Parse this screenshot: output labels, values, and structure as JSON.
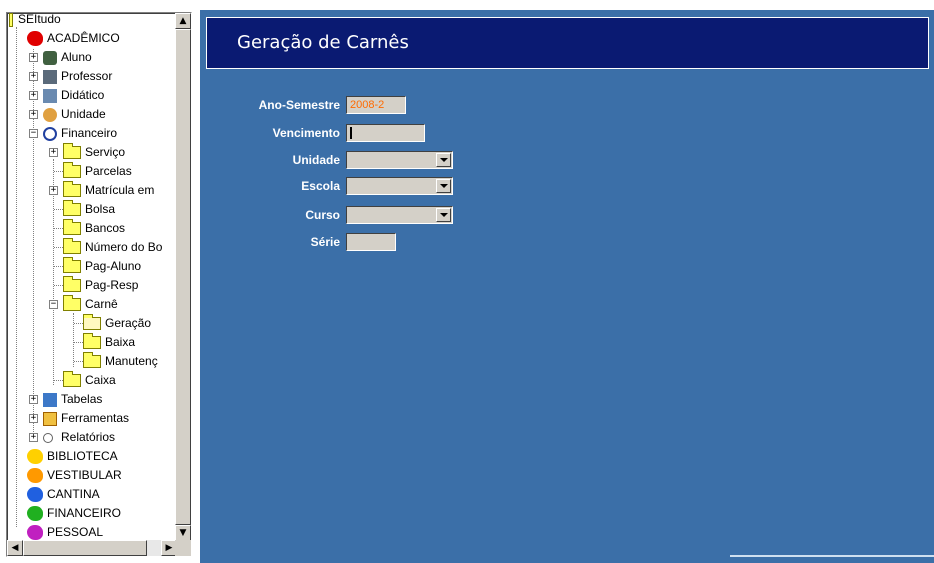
{
  "tree": {
    "root": "SEItudo",
    "items": [
      {
        "label": "ACADÊMICO"
      },
      {
        "label": "Aluno"
      },
      {
        "label": "Professor"
      },
      {
        "label": "Didático"
      },
      {
        "label": "Unidade"
      },
      {
        "label": "Financeiro"
      },
      {
        "label": "Serviço"
      },
      {
        "label": "Parcelas"
      },
      {
        "label": "Matrícula em"
      },
      {
        "label": "Bolsa"
      },
      {
        "label": "Bancos"
      },
      {
        "label": "Número do Bo"
      },
      {
        "label": "Pag-Aluno"
      },
      {
        "label": "Pag-Resp"
      },
      {
        "label": "Carnê"
      },
      {
        "label": "Geração"
      },
      {
        "label": "Baixa"
      },
      {
        "label": "Manutenç"
      },
      {
        "label": "Caixa"
      },
      {
        "label": "Tabelas"
      },
      {
        "label": "Ferramentas"
      },
      {
        "label": "Relatórios"
      },
      {
        "label": "BIBLIOTECA"
      },
      {
        "label": "VESTIBULAR"
      },
      {
        "label": "CANTINA"
      },
      {
        "label": "FINANCEIRO"
      },
      {
        "label": "PESSOAL"
      }
    ]
  },
  "main": {
    "title": "Geração de Carnês",
    "form": {
      "ano_semestre": {
        "label": "Ano-Semestre",
        "value": "2008-2"
      },
      "vencimento": {
        "label": "Vencimento",
        "value": ""
      },
      "unidade": {
        "label": "Unidade",
        "value": ""
      },
      "escola": {
        "label": "Escola",
        "value": ""
      },
      "curso": {
        "label": "Curso",
        "value": ""
      },
      "serie": {
        "label": "Série",
        "value": ""
      }
    }
  },
  "colors": {
    "panel_bg": "#3b6fa8",
    "title_bar": "#0a1a72",
    "field_value_accent": "#ff6a00",
    "folder": "#ffff66"
  }
}
